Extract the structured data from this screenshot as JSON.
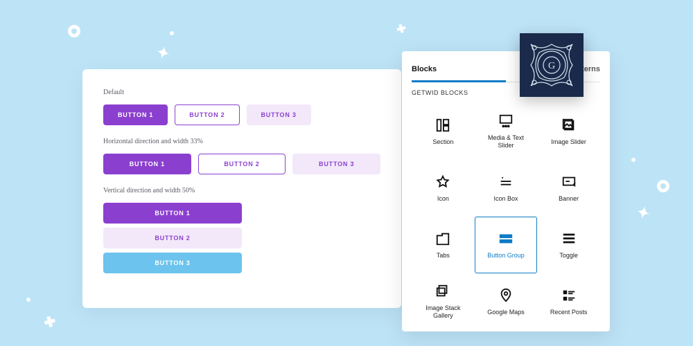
{
  "editor": {
    "section1": {
      "label": "Default",
      "buttons": [
        "BUTTON 1",
        "BUTTON 2",
        "BUTTON 3"
      ]
    },
    "section2": {
      "label": "Horizontal direction and width 33%",
      "buttons": [
        "BUTTON 1",
        "BUTTON 2",
        "BUTTON 3"
      ]
    },
    "section3": {
      "label": "Vertical direction and width 50%",
      "buttons": [
        "BUTTON 1",
        "BUTTON 2",
        "BUTTON 3"
      ]
    }
  },
  "inserter": {
    "tabs": {
      "blocks": "Blocks",
      "patterns": "Patterns",
      "active": "blocks"
    },
    "category": "GETWID BLOCKS",
    "blocks": [
      {
        "id": "section",
        "label": "Section"
      },
      {
        "id": "media-text-slider",
        "label": "Media & Text Slider"
      },
      {
        "id": "image-slider",
        "label": "Image Slider"
      },
      {
        "id": "icon",
        "label": "Icon"
      },
      {
        "id": "icon-box",
        "label": "Icon Box"
      },
      {
        "id": "banner",
        "label": "Banner"
      },
      {
        "id": "tabs",
        "label": "Tabs"
      },
      {
        "id": "button-group",
        "label": "Button Group",
        "selected": true
      },
      {
        "id": "toggle",
        "label": "Toggle"
      },
      {
        "id": "image-stack-gallery",
        "label": "Image Stack Gallery"
      },
      {
        "id": "google-maps",
        "label": "Google Maps"
      },
      {
        "id": "recent-posts",
        "label": "Recent Posts"
      }
    ]
  },
  "brand": {
    "name": "Getwid"
  }
}
